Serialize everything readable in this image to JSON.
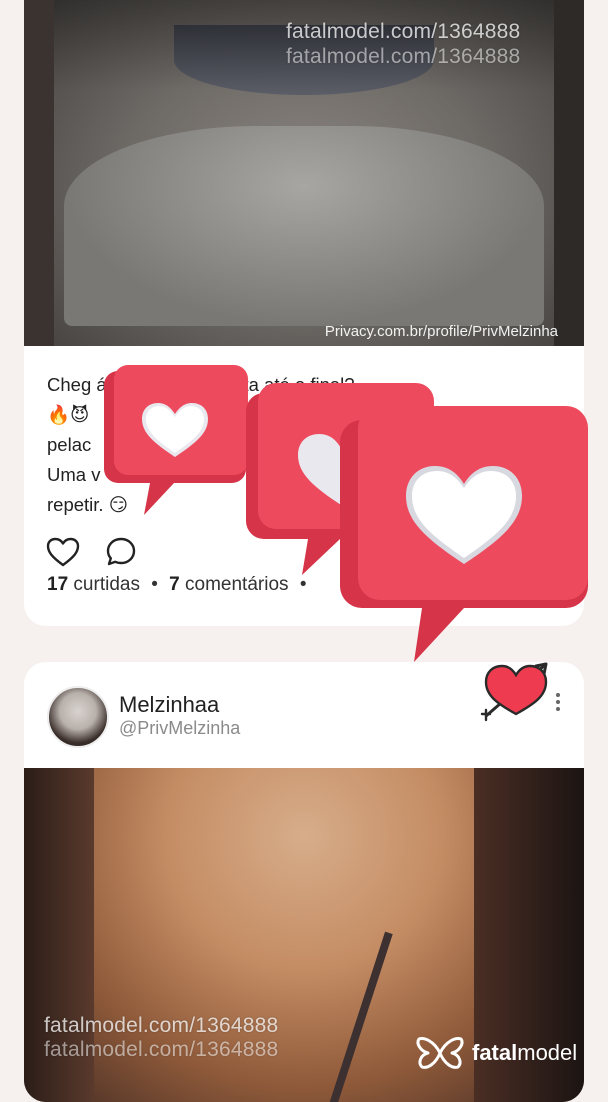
{
  "post1": {
    "media_caption": "Privacy.com.br/profile/PrivMelzinha",
    "watermark": "fatalmodel.com/1364888",
    "text_lines": [
      "Cheg                        á que você aguenta até o final?",
      "🔥😈",
      "pelac",
      "Uma v",
      "repetir. 😏"
    ],
    "like_count": "17",
    "likes_label": "curtidas",
    "comment_count": "7",
    "comments_label": "comentários",
    "separator": "•"
  },
  "post2": {
    "author_name": "Melzinhaa",
    "author_handle": "@PrivMelzinha",
    "watermark": "fatalmodel.com/1364888"
  },
  "brand": {
    "name_bold": "fatal",
    "name_regular": "model"
  },
  "colors": {
    "accent": "#ee4a5e",
    "accent_dark": "#d63448",
    "background": "#f6f1ee"
  },
  "icons": {
    "like": "heart-outline-icon",
    "comment": "speech-bubble-icon",
    "more": "vertical-dots-icon",
    "stickers": [
      "heart-speech-bubble-sticker",
      "heart-arrow-sticker"
    ],
    "logo": "butterfly-logo-icon"
  }
}
